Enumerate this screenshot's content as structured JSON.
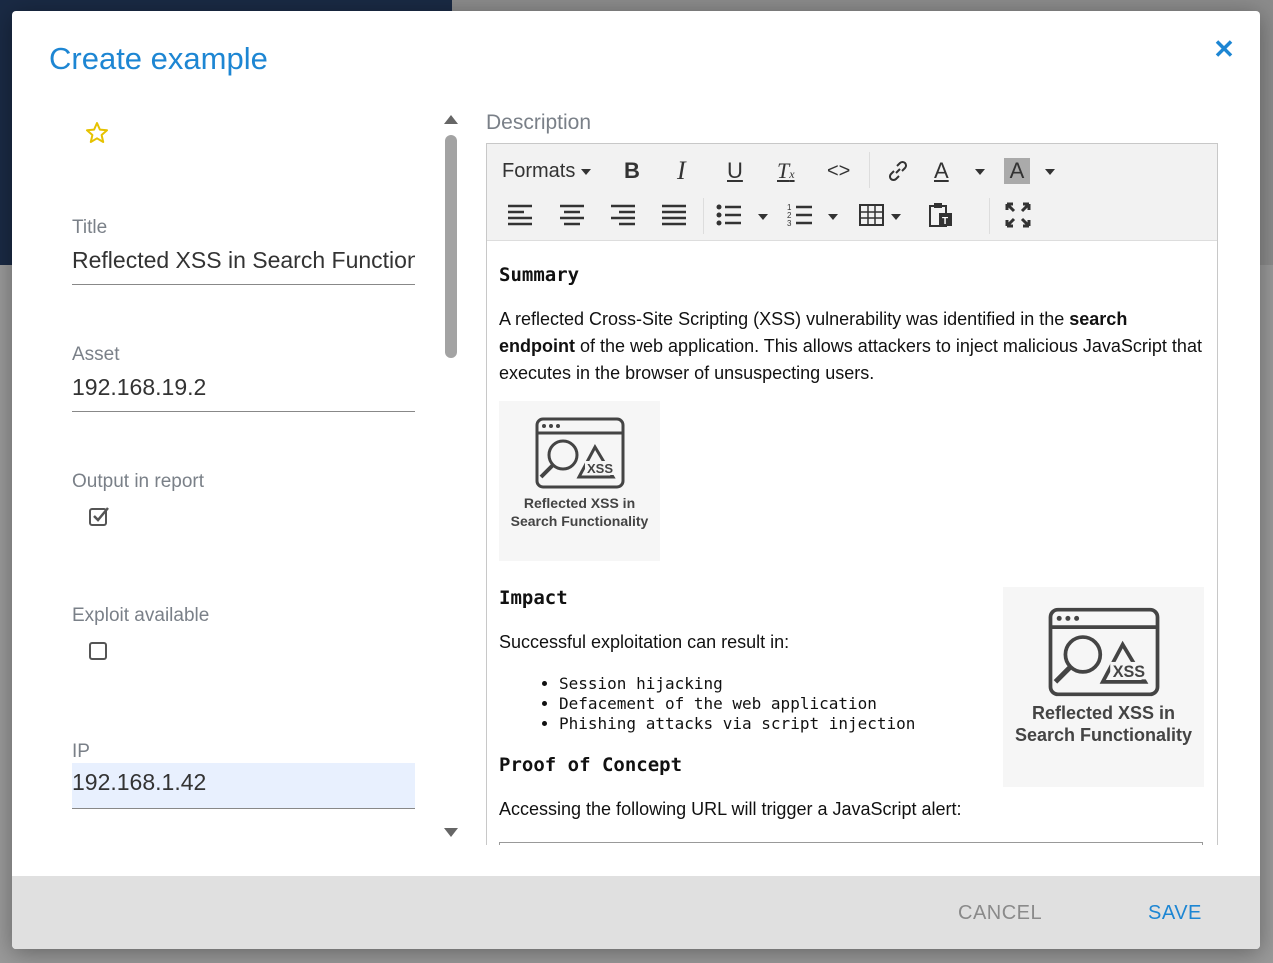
{
  "modal": {
    "title": "Create example"
  },
  "fields": {
    "title": {
      "label": "Title",
      "value": "Reflected XSS in Search Function"
    },
    "asset": {
      "label": "Asset",
      "value": "192.168.19.2"
    },
    "output_in_report": {
      "label": "Output in report",
      "checked": true
    },
    "exploit_available": {
      "label": "Exploit available",
      "checked": false
    },
    "ip": {
      "label": "IP",
      "value": "192.168.1.42"
    }
  },
  "description": {
    "label": "Description",
    "toolbar": {
      "formats_label": "Formats"
    },
    "content": {
      "summary_heading": "Summary",
      "summary_text_1": "A reflected Cross-Site Scripting (XSS) vulnerability was identified in the ",
      "summary_bold": "search endpoint",
      "summary_text_2": " of the web application. This allows attackers to inject malicious JavaScript that executes in the browser of unsuspecting users.",
      "image_caption_1": "Reflected XSS in",
      "image_caption_2": "Search Functionality",
      "image_badge": "XSS",
      "impact_heading": "Impact",
      "impact_intro": "Successful exploitation can result in:",
      "impact_items": [
        "Session hijacking",
        "Defacement of the web application",
        "Phishing attacks via script injection"
      ],
      "poc_heading": "Proof of Concept",
      "poc_text": "Accessing the following URL will trigger a JavaScript alert:"
    }
  },
  "footer": {
    "cancel_label": "CANCEL",
    "save_label": "SAVE"
  },
  "colors": {
    "accent": "#1d86d3",
    "star": "#e6c200"
  }
}
